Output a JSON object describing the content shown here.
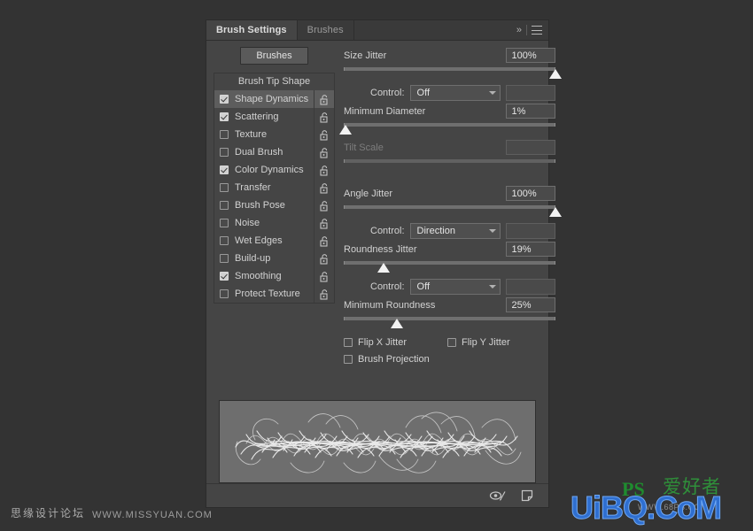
{
  "app": {
    "background_color": "#333333"
  },
  "panel": {
    "tabs": [
      {
        "label": "Brush Settings",
        "active": true
      },
      {
        "label": "Brushes",
        "active": false
      }
    ],
    "header_icons": {
      "collapse": "»",
      "menu": "hamburger-icon"
    },
    "brushes_button": "Brushes",
    "option_list": {
      "header": "Brush Tip Shape",
      "items": [
        {
          "label": "Shape Dynamics",
          "checked": true,
          "selected": true
        },
        {
          "label": "Scattering",
          "checked": true,
          "selected": false
        },
        {
          "label": "Texture",
          "checked": false,
          "selected": false
        },
        {
          "label": "Dual Brush",
          "checked": false,
          "selected": false
        },
        {
          "label": "Color Dynamics",
          "checked": true,
          "selected": false
        },
        {
          "label": "Transfer",
          "checked": false,
          "selected": false
        },
        {
          "label": "Brush Pose",
          "checked": false,
          "selected": false
        },
        {
          "label": "Noise",
          "checked": false,
          "selected": false
        },
        {
          "label": "Wet Edges",
          "checked": false,
          "selected": false
        },
        {
          "label": "Build-up",
          "checked": false,
          "selected": false
        },
        {
          "label": "Smoothing",
          "checked": true,
          "selected": false
        },
        {
          "label": "Protect Texture",
          "checked": false,
          "selected": false
        }
      ],
      "lock_icon": "unlocked-padlock-icon"
    },
    "controls": {
      "size_jitter": {
        "label": "Size Jitter",
        "value": "100%",
        "slider_pct": 100
      },
      "size_jitter_control": {
        "label": "Control:",
        "value": "Off",
        "side_value": ""
      },
      "minimum_diameter": {
        "label": "Minimum Diameter",
        "value": "1%",
        "slider_pct": 1
      },
      "tilt_scale": {
        "label": "Tilt Scale",
        "value": "",
        "slider_pct": 0,
        "disabled": true
      },
      "angle_jitter": {
        "label": "Angle Jitter",
        "value": "100%",
        "slider_pct": 100
      },
      "angle_jitter_control": {
        "label": "Control:",
        "value": "Direction",
        "side_value": ""
      },
      "roundness_jitter": {
        "label": "Roundness Jitter",
        "value": "19%",
        "slider_pct": 19
      },
      "roundness_jitter_control": {
        "label": "Control:",
        "value": "Off",
        "side_value": ""
      },
      "minimum_roundness": {
        "label": "Minimum Roundness",
        "value": "25%",
        "slider_pct": 25
      },
      "flip_x_jitter": {
        "label": "Flip X Jitter",
        "checked": false
      },
      "flip_y_jitter": {
        "label": "Flip Y Jitter",
        "checked": false
      },
      "brush_projection": {
        "label": "Brush Projection",
        "checked": false
      }
    },
    "footer_icons": {
      "toggle_brush_preview": "eye-brush-icon",
      "create_new_brush": "new-brush-icon"
    }
  },
  "watermarks": {
    "left_cn": "思缘设计论坛",
    "left_url": "WWW.MISSYUAN.COM",
    "right_main": "UiBQ.CoM",
    "right_ps": "PS",
    "right_cn": "爱好者",
    "right_url": "WWW.68PS.COM"
  }
}
